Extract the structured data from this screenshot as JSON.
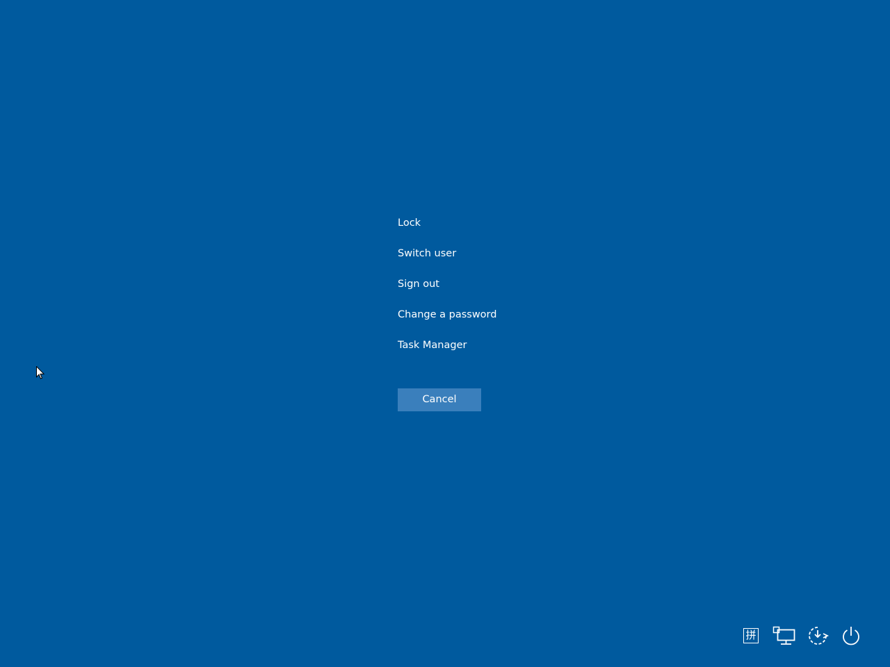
{
  "menu": {
    "items": [
      {
        "label": "Lock"
      },
      {
        "label": "Switch user"
      },
      {
        "label": "Sign out"
      },
      {
        "label": "Change a password"
      },
      {
        "label": "Task Manager"
      }
    ]
  },
  "cancel": {
    "label": "Cancel"
  },
  "tray": {
    "ime": {
      "label": "拼",
      "icon": "input-method-icon"
    },
    "network": {
      "icon": "network-icon"
    },
    "ease_of_access": {
      "icon": "ease-of-access-icon"
    },
    "power": {
      "icon": "power-icon"
    }
  },
  "colors": {
    "background": "#005a9e",
    "button": "#3a7fbc",
    "text": "#ffffff"
  }
}
